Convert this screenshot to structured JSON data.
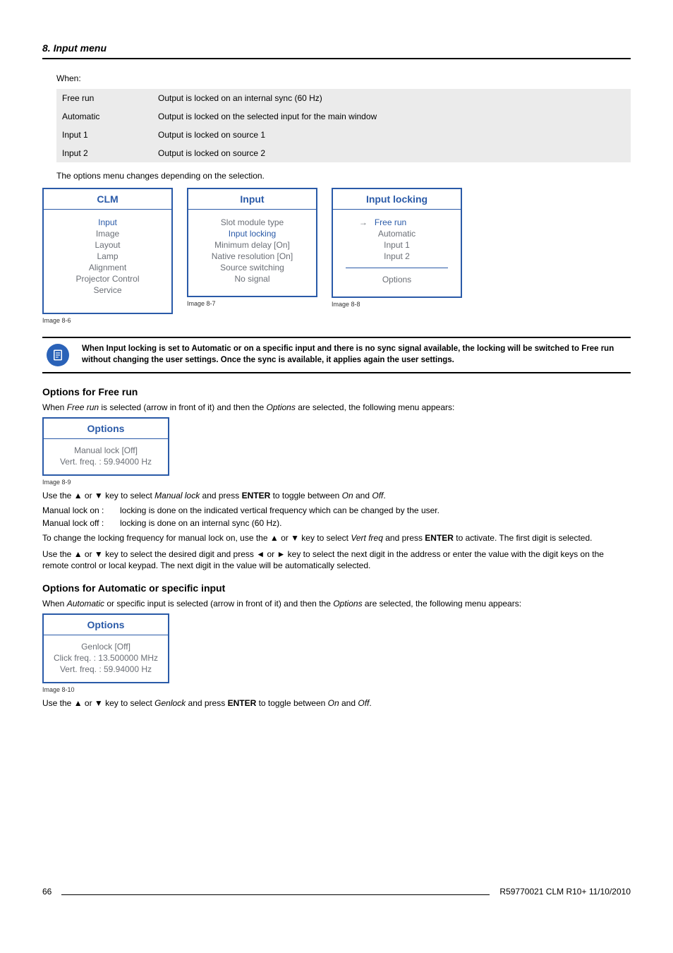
{
  "header": {
    "title": "8.  Input menu"
  },
  "when_label": "When:",
  "options_table": {
    "rows": [
      {
        "name": "Free run",
        "desc": "Output is locked on an internal sync (60 Hz)"
      },
      {
        "name": "Automatic",
        "desc": "Output is locked on the selected input for the main window"
      },
      {
        "name": "Input 1",
        "desc": "Output is locked on source 1"
      },
      {
        "name": "Input 2",
        "desc": "Output is locked on source 2"
      }
    ]
  },
  "options_note": "The options menu changes depending on the selection.",
  "menus": {
    "clm": {
      "title": "CLM",
      "sel": "Input",
      "items": [
        "Image",
        "Layout",
        "Lamp",
        "Alignment",
        "Projector Control",
        "Service"
      ],
      "caption": "Image 8-6"
    },
    "input": {
      "title": "Input",
      "items": [
        "Slot module type"
      ],
      "hl": "Input locking",
      "items2": [
        "Minimum delay [On]",
        "Native resolution [On]",
        "Source switching",
        "No signal"
      ],
      "caption": "Image 8-7"
    },
    "input_locking": {
      "title": "Input locking",
      "arrow": "→",
      "sel": "Free run",
      "items": [
        "Automatic",
        "Input 1",
        "Input 2"
      ],
      "options": "Options",
      "caption": "Image 8-8"
    }
  },
  "note": {
    "text": "When Input locking is set to Automatic or on a specific input and there is no sync signal available, the locking will be switched to Free run without changing the user settings.  Once the sync is available, it applies again the user settings."
  },
  "section_free": {
    "title": "Options for Free run",
    "intro_pre": "When ",
    "intro_em1": "Free run",
    "intro_mid": " is selected (arrow in front of it) and then the ",
    "intro_em2": "Options",
    "intro_post": " are selected, the following menu appears:",
    "menu": {
      "title": "Options",
      "l1": "Manual lock [Off]",
      "l2": "Vert. freq. : 59.94000 Hz",
      "caption": "Image 8-9"
    },
    "use_pre": "Use the ▲ or ▼ key to select ",
    "use_em": "Manual lock",
    "use_mid": " and press ",
    "use_strong": "ENTER",
    "use_mid2": " to toggle between ",
    "use_em_on": "On",
    "use_and": " and ",
    "use_em_off": "Off",
    "use_post": ".",
    "def1_term": "Manual lock on :",
    "def1_desc": "locking is done on the indicated vertical frequency which can be changed by the user.",
    "def2_term": "Manual lock off :",
    "def2_desc": "locking is done on an internal sync (60 Hz).",
    "p2_pre": "To change the locking frequency for manual lock on, use the ▲ or ▼ key to select ",
    "p2_em": "Vert freq",
    "p2_mid": " and press ",
    "p2_strong": "ENTER",
    "p2_post": " to activate. The first digit is selected.",
    "p3": "Use the ▲ or ▼ key to select the desired digit and press ◄ or ► key to select the next digit in the address or enter the value with the digit keys on the remote control or local keypad. The next digit in the value will be automatically selected."
  },
  "section_auto": {
    "title": "Options for Automatic or specific input",
    "intro_pre": "When ",
    "intro_em1": "Automatic",
    "intro_mid1": " or specific input is selected (arrow in front of it) and then the ",
    "intro_em2": "Options",
    "intro_post": " are selected, the following menu appears:",
    "menu": {
      "title": "Options",
      "l1": "Genlock [Off]",
      "l2": "Click freq. : 13.500000 MHz",
      "l3": "Vert. freq. : 59.94000 Hz",
      "caption": "Image 8-10"
    },
    "use_pre": "Use the ▲ or ▼ key to select ",
    "use_em": "Genlock",
    "use_mid": " and press ",
    "use_strong": "ENTER",
    "use_mid2": " to toggle between ",
    "use_em_on": "On",
    "use_and": " and ",
    "use_em_off": "Off",
    "use_post": "."
  },
  "footer": {
    "page": "66",
    "doc": "R59770021  CLM R10+  11/10/2010"
  }
}
